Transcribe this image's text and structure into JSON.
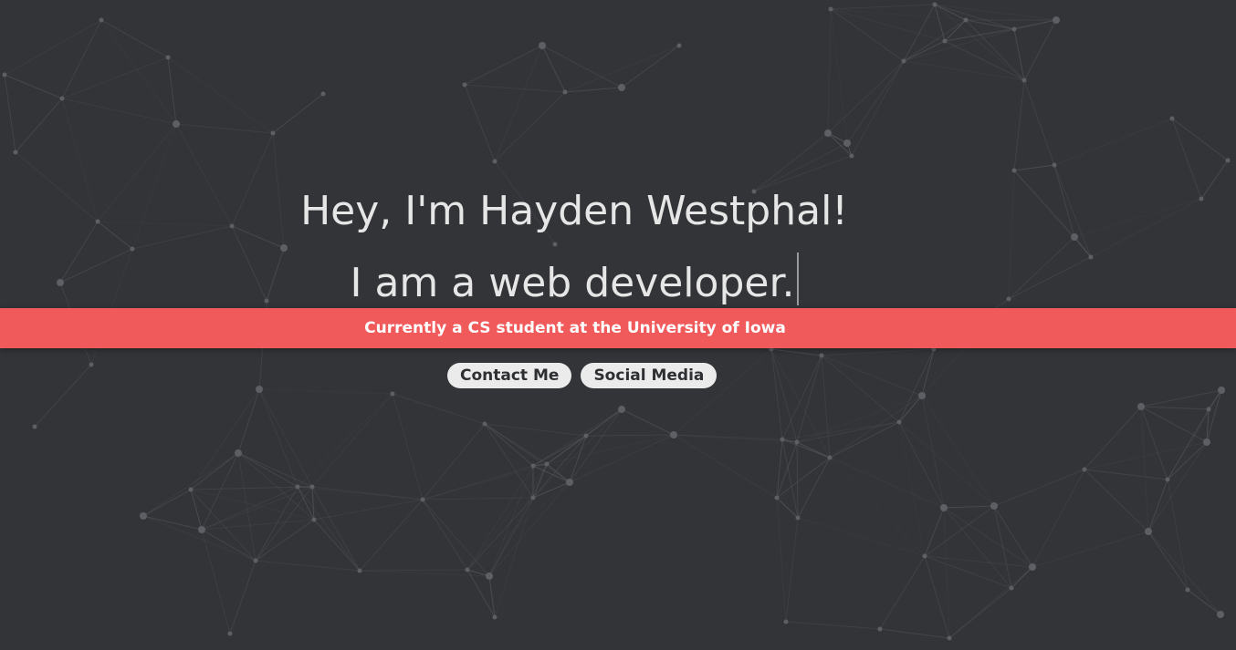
{
  "hero": {
    "greeting": "Hey, I'm Hayden Westphal!",
    "tagline": "I am a web developer."
  },
  "banner": {
    "text": "Currently a CS student at the University of Iowa",
    "color": "#f05a5b"
  },
  "buttons": {
    "contact_label": "Contact Me",
    "social_label": "Social Media"
  },
  "theme": {
    "background": "#333438",
    "text": "#e6e6e6",
    "button_bg": "#ebebeb"
  }
}
